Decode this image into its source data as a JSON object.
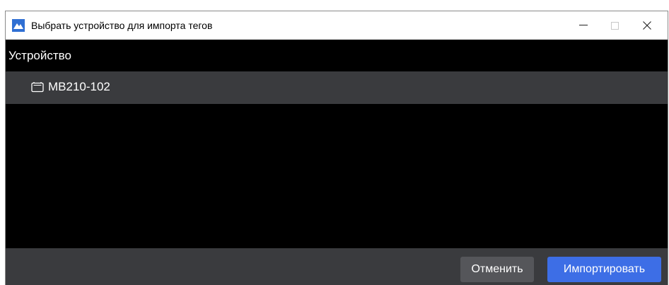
{
  "window": {
    "title": "Выбрать устройство для импорта тегов",
    "controls": {
      "minimize_glyph": "—",
      "maximize_glyph": "☐",
      "close_glyph": "✕"
    }
  },
  "list": {
    "column_header": "Устройство",
    "items": [
      {
        "label": "MB210-102",
        "icon": "device-icon",
        "selected": true
      }
    ]
  },
  "footer": {
    "cancel_label": "Отменить",
    "import_label": "Импортировать"
  },
  "colors": {
    "accent": "#3d6ee6",
    "selected_row": "#3a3b3e",
    "background": "#000000"
  }
}
